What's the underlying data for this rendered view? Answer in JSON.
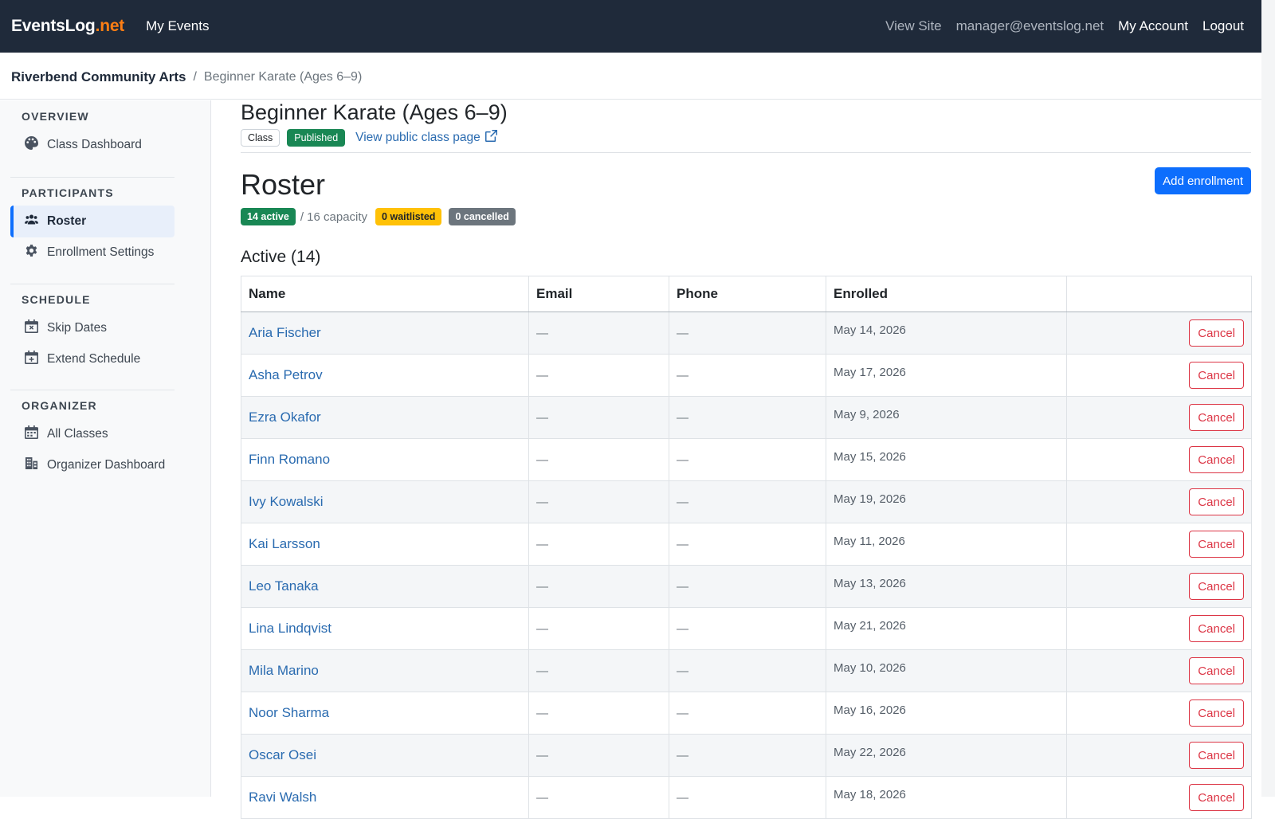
{
  "navbar": {
    "brand_main": "EventsLog",
    "brand_accent": ".net",
    "my_events": "My Events",
    "view_site": "View Site",
    "email": "manager@eventslog.net",
    "my_account": "My Account",
    "logout": "Logout"
  },
  "breadcrumb": {
    "org": "Riverbend Community Arts",
    "separator": "/",
    "current": "Beginner Karate (Ages 6–9)"
  },
  "sidebar": {
    "overview": {
      "heading": "OVERVIEW",
      "items": [
        {
          "label": "Class Dashboard",
          "icon": "palette-icon"
        }
      ]
    },
    "participants": {
      "heading": "PARTICIPANTS",
      "items": [
        {
          "label": "Roster",
          "icon": "users-icon",
          "active": true
        },
        {
          "label": "Enrollment Settings",
          "icon": "gear-icon"
        }
      ]
    },
    "schedule": {
      "heading": "SCHEDULE",
      "items": [
        {
          "label": "Skip Dates",
          "icon": "calendar-x-icon"
        },
        {
          "label": "Extend Schedule",
          "icon": "calendar-plus-icon"
        }
      ]
    },
    "organizer": {
      "heading": "ORGANIZER",
      "items": [
        {
          "label": "All Classes",
          "icon": "calendar-icon"
        },
        {
          "label": "Organizer Dashboard",
          "icon": "building-icon"
        }
      ]
    }
  },
  "class": {
    "title": "Beginner Karate (Ages 6–9)",
    "type_badge": "Class",
    "status_badge": "Published",
    "public_link": "View public class page"
  },
  "roster": {
    "title": "Roster",
    "add_button": "Add enrollment",
    "active_badge": "14 active",
    "capacity_text": "/ 16 capacity",
    "waitlisted_badge": "0 waitlisted",
    "cancelled_badge": "0 cancelled",
    "active_heading": "Active (14)",
    "columns": [
      "Name",
      "Email",
      "Phone",
      "Enrolled",
      ""
    ],
    "cancel_label": "Cancel",
    "rows": [
      {
        "name": "Aria Fischer",
        "email": "—",
        "phone": "—",
        "enrolled": "May 14, 2026"
      },
      {
        "name": "Asha Petrov",
        "email": "—",
        "phone": "—",
        "enrolled": "May 17, 2026"
      },
      {
        "name": "Ezra Okafor",
        "email": "—",
        "phone": "—",
        "enrolled": "May 9, 2026"
      },
      {
        "name": "Finn Romano",
        "email": "—",
        "phone": "—",
        "enrolled": "May 15, 2026"
      },
      {
        "name": "Ivy Kowalski",
        "email": "—",
        "phone": "—",
        "enrolled": "May 19, 2026"
      },
      {
        "name": "Kai Larsson",
        "email": "—",
        "phone": "—",
        "enrolled": "May 11, 2026"
      },
      {
        "name": "Leo Tanaka",
        "email": "—",
        "phone": "—",
        "enrolled": "May 13, 2026"
      },
      {
        "name": "Lina Lindqvist",
        "email": "—",
        "phone": "—",
        "enrolled": "May 21, 2026"
      },
      {
        "name": "Mila Marino",
        "email": "—",
        "phone": "—",
        "enrolled": "May 10, 2026"
      },
      {
        "name": "Noor Sharma",
        "email": "—",
        "phone": "—",
        "enrolled": "May 16, 2026"
      },
      {
        "name": "Oscar Osei",
        "email": "—",
        "phone": "—",
        "enrolled": "May 22, 2026"
      },
      {
        "name": "Ravi Walsh",
        "email": "—",
        "phone": "—",
        "enrolled": "May 18, 2026"
      }
    ]
  }
}
